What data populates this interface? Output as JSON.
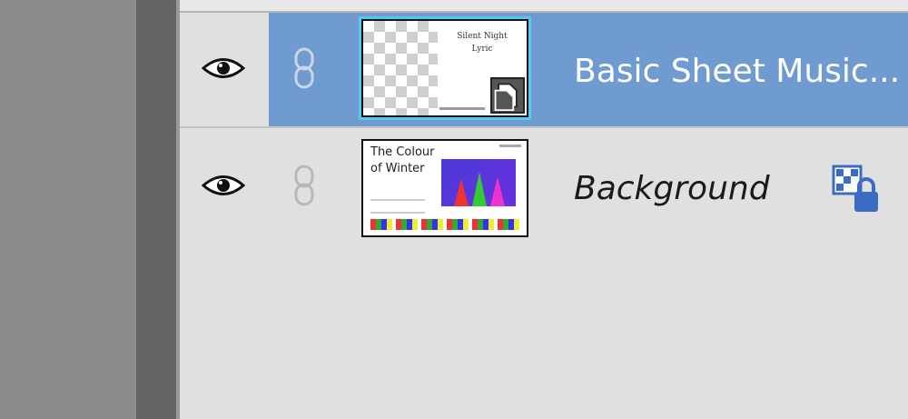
{
  "layers": [
    {
      "name": "Basic Sheet Music...",
      "selected": true,
      "visible": true,
      "thumbnail_text": [
        "Silent Night",
        "Lyric"
      ]
    },
    {
      "name": "Background",
      "selected": false,
      "visible": true,
      "locked": true,
      "thumbnail_title": [
        "The Colour",
        "of Winter"
      ]
    }
  ],
  "colors": {
    "selection": "#6f9bd0",
    "thumbnail_highlight": "#54c8ee",
    "panel_bg": "#e0e0e0",
    "lock_icon": "#3b6cc4"
  },
  "icons": [
    "eye-icon",
    "link-icon",
    "smart-object-badge-icon",
    "lock-icon"
  ]
}
